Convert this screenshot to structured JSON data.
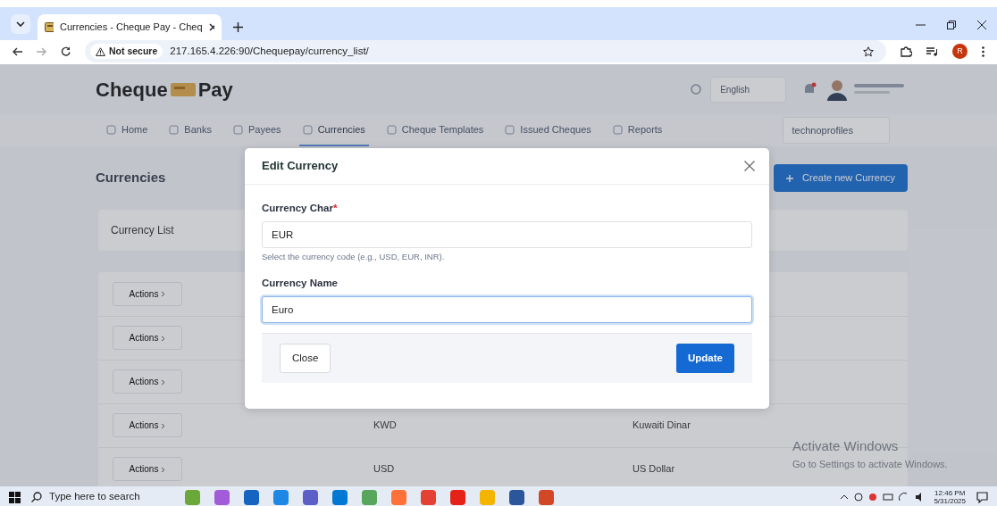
{
  "browser": {
    "tab_title": "Currencies - Cheque Pay - Cheq",
    "security": "Not secure",
    "url": "217.165.4.226:90/Chequepay/currency_list/",
    "profile_initial": "R"
  },
  "app": {
    "logo_left": "Cheque",
    "logo_right": "Pay",
    "language": "English",
    "nav": [
      {
        "label": "Home",
        "selected": false
      },
      {
        "label": "Banks",
        "selected": false
      },
      {
        "label": "Payees",
        "selected": false
      },
      {
        "label": "Currencies",
        "selected": true
      },
      {
        "label": "Cheque Templates",
        "selected": false
      },
      {
        "label": "Issued Cheques",
        "selected": false
      },
      {
        "label": "Reports",
        "selected": false
      }
    ],
    "company": "technoprofiles",
    "page_title": "Currencies",
    "create_button": "Create new Currency",
    "card_title": "Currency List",
    "rows": [
      {
        "action": "Actions"
      },
      {
        "action": "Actions"
      },
      {
        "action": "Actions"
      },
      {
        "action": "Actions",
        "code": "KWD",
        "name": "Kuwaiti Dinar"
      },
      {
        "action": "Actions",
        "code": "USD",
        "name": "US Dollar"
      }
    ]
  },
  "modal": {
    "title": "Edit Currency",
    "fields": [
      {
        "label": "Currency Char",
        "required_mark": "*",
        "value": "EUR",
        "help": "Select the currency code (e.g., USD, EUR, INR).",
        "focused": false
      },
      {
        "label": "Currency Name",
        "value": "Euro",
        "focused": true
      }
    ],
    "buttons": [
      {
        "label": "Close",
        "kind": "secondary"
      },
      {
        "label": "Update",
        "kind": "primary"
      }
    ]
  },
  "os_notice": {
    "title": "Activate Windows",
    "subtitle": "Go to Settings to activate Windows."
  },
  "taskbar": {
    "search_placeholder": "Type here to search",
    "time": "12:46 PM",
    "date": "5/31/2025"
  }
}
